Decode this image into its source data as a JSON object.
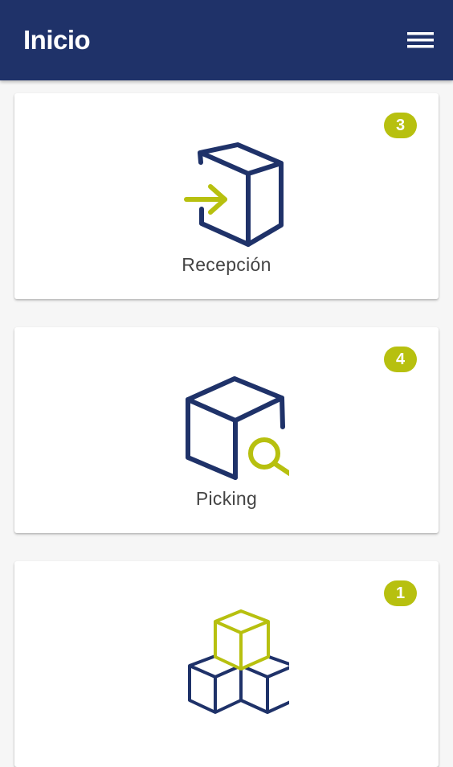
{
  "header": {
    "title": "Inicio",
    "menu_icon": "hamburger-menu-icon"
  },
  "colors": {
    "primary": "#1f3269",
    "accent": "#b7c00f",
    "background": "#f6f6f6",
    "card": "#ffffff",
    "label_text": "#444444"
  },
  "cards": [
    {
      "label": "Recepción",
      "badge": "3",
      "icon": "box-arrow-in-icon"
    },
    {
      "label": "Picking",
      "badge": "4",
      "icon": "box-search-icon"
    },
    {
      "label": "",
      "badge": "1",
      "icon": "stacked-boxes-icon"
    }
  ]
}
